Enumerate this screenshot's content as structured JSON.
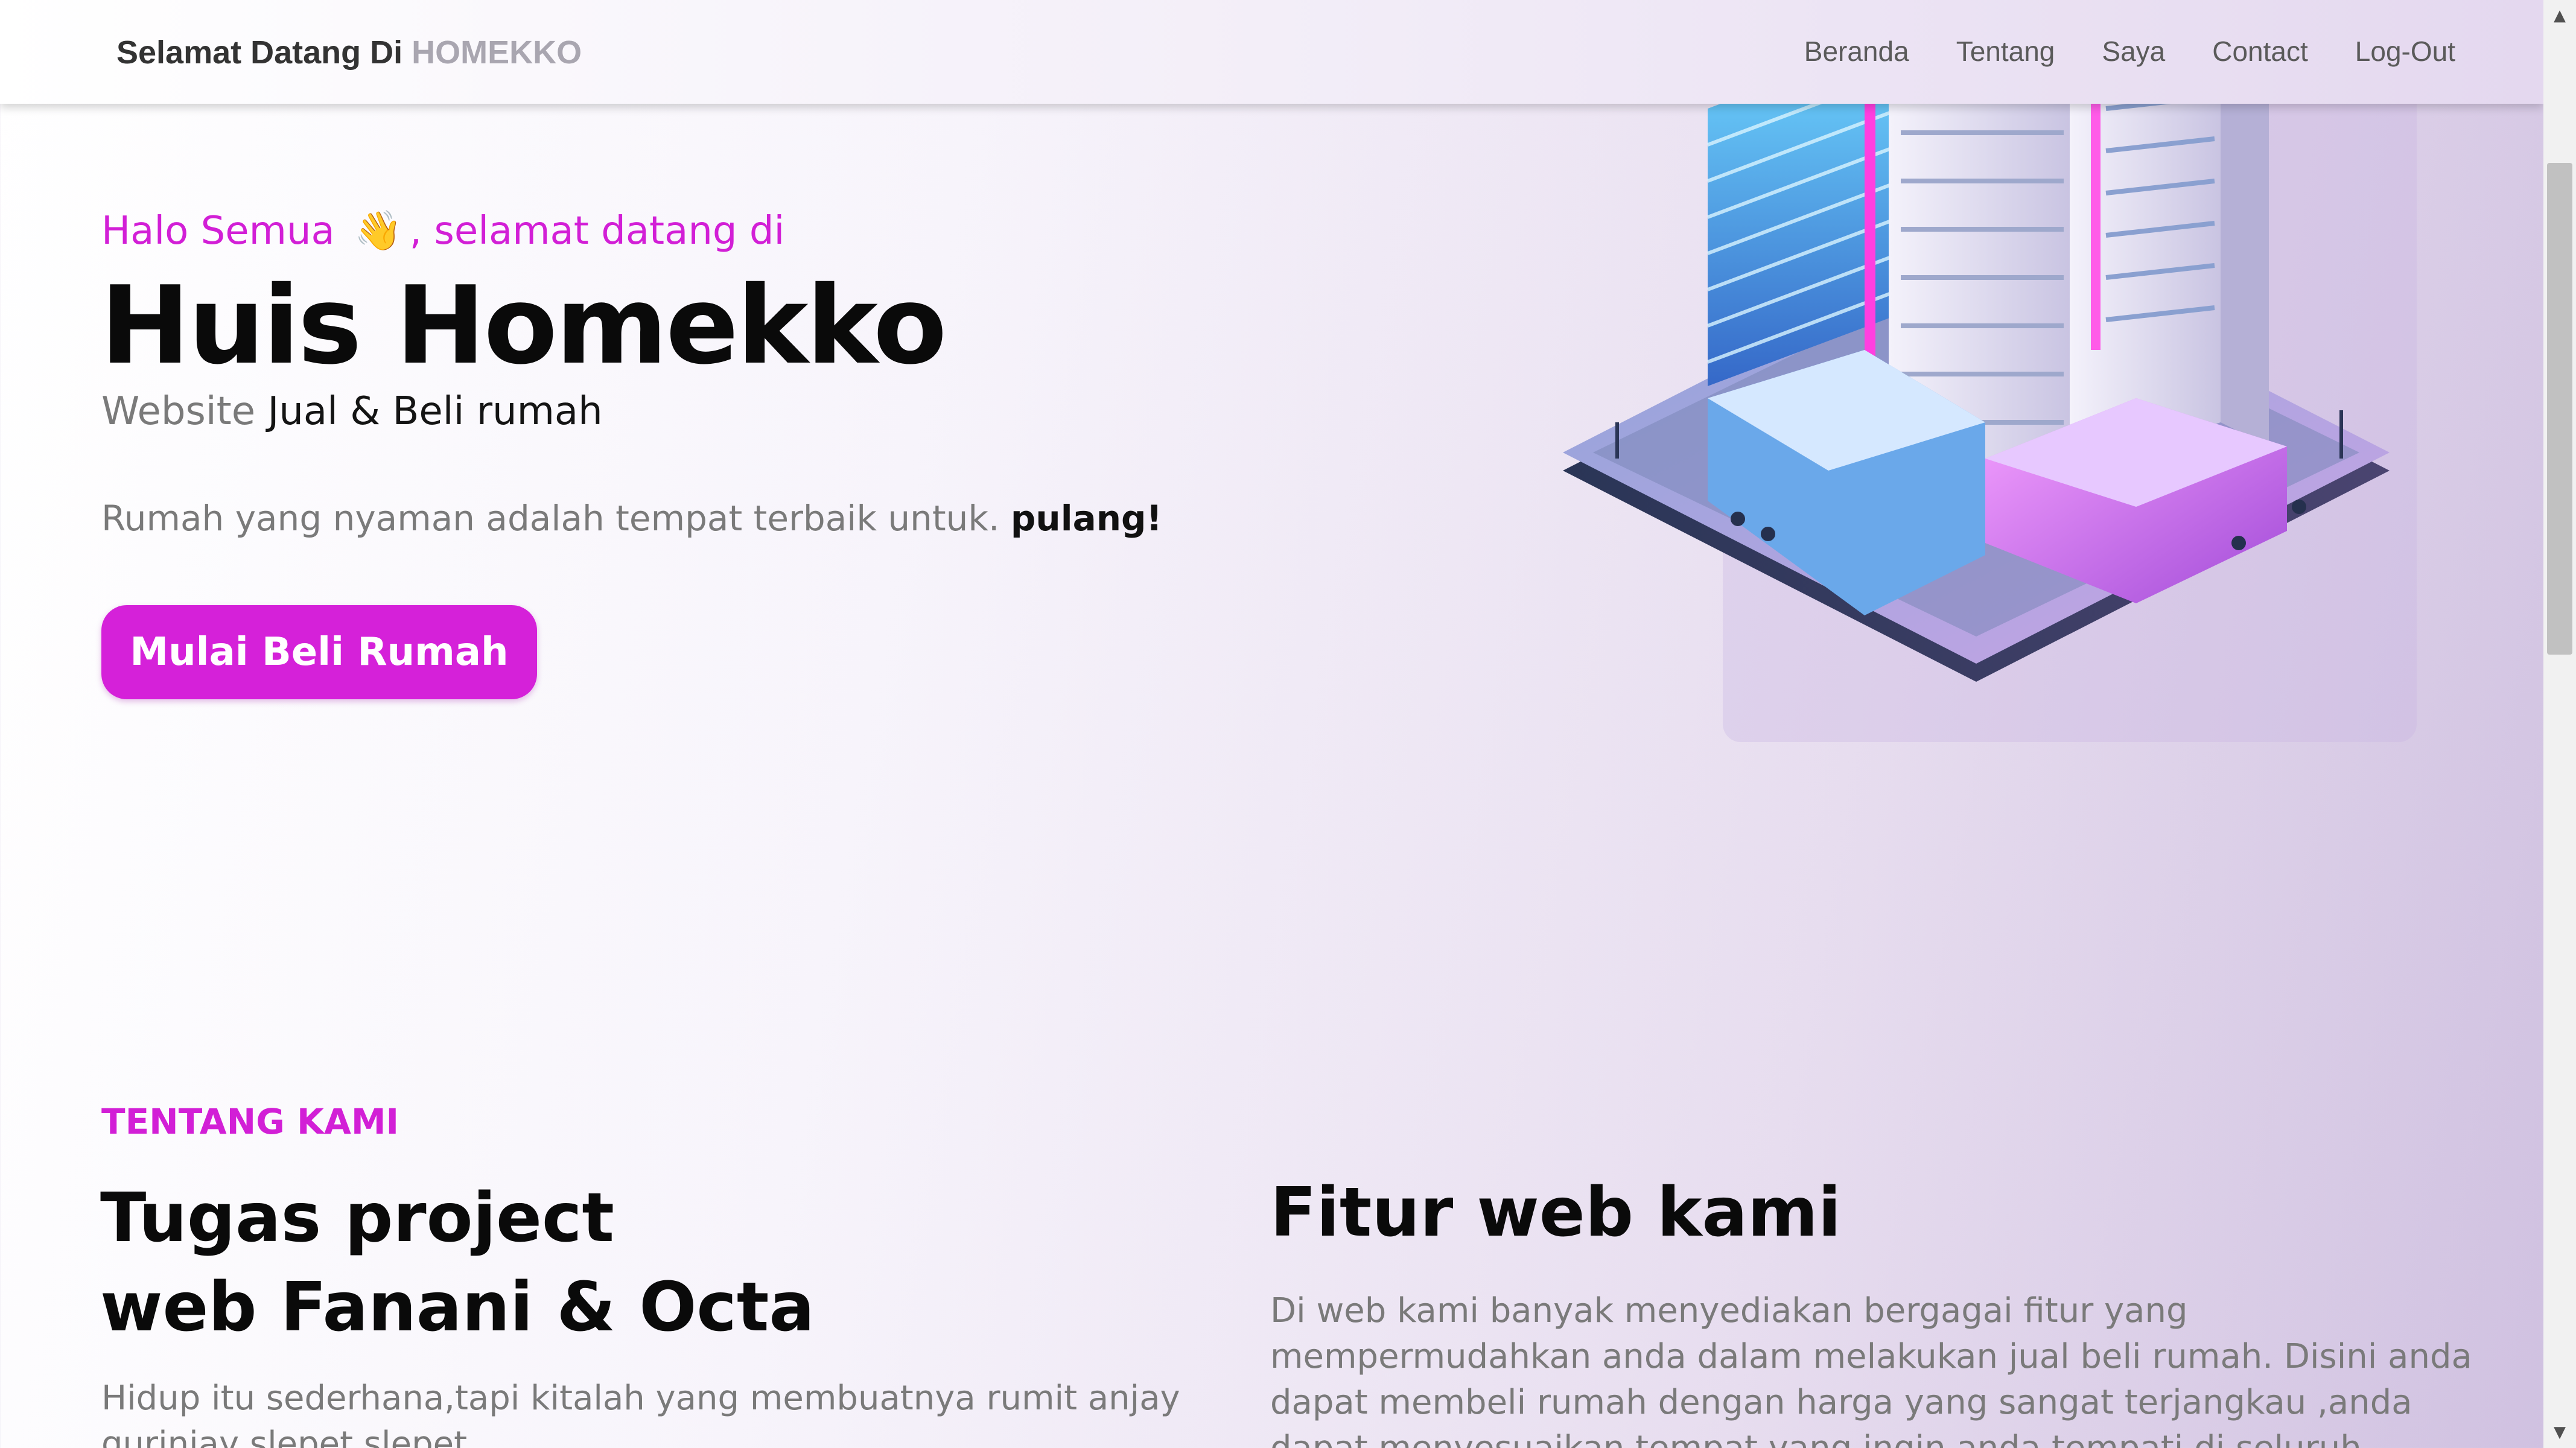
{
  "navbar": {
    "brand_prefix": "Selamat Datang Di",
    "brand_name": "HOMEKKO",
    "links": [
      "Beranda",
      "Tentang",
      "Saya",
      "Contact",
      "Log-Out"
    ]
  },
  "hero": {
    "greeting_start": "Halo Semua",
    "greeting_emoji": "👋",
    "greeting_end": ", selamat datang di",
    "title": "Huis Homekko",
    "subtitle_muted": "Website",
    "subtitle_rest": "Jual & Beli rumah",
    "description": "Rumah yang nyaman adalah tempat terbaik untuk.",
    "description_bold": "pulang!",
    "cta_label": "Mulai Beli Rumah"
  },
  "about": {
    "label": "TENTANG KAMI",
    "title_line1": "Tugas project",
    "title_line2": "web Fanani & Octa",
    "description": "Hidup itu sederhana,tapi kitalah yang membuatnya rumit anjay gurinjay slepet slepet"
  },
  "features": {
    "title": "Fitur web kami",
    "description": "Di web kami banyak menyediakan bergagai fitur yang mempermudahkan anda dalam melakukan jual beli rumah. Disini anda dapat membeli rumah dengan harga yang sangat terjangkau ,anda dapat menyesuaikan tempat yang ingin anda tempati di seluruh bagian wilayah kota di Indonesia."
  },
  "colors": {
    "accent": "#d521d9",
    "text_dark": "#0a0a0a",
    "text_muted": "#7a7a7a"
  },
  "icons": {
    "scroll_up": "chevron-up-icon",
    "scroll_down": "chevron-down-icon"
  }
}
